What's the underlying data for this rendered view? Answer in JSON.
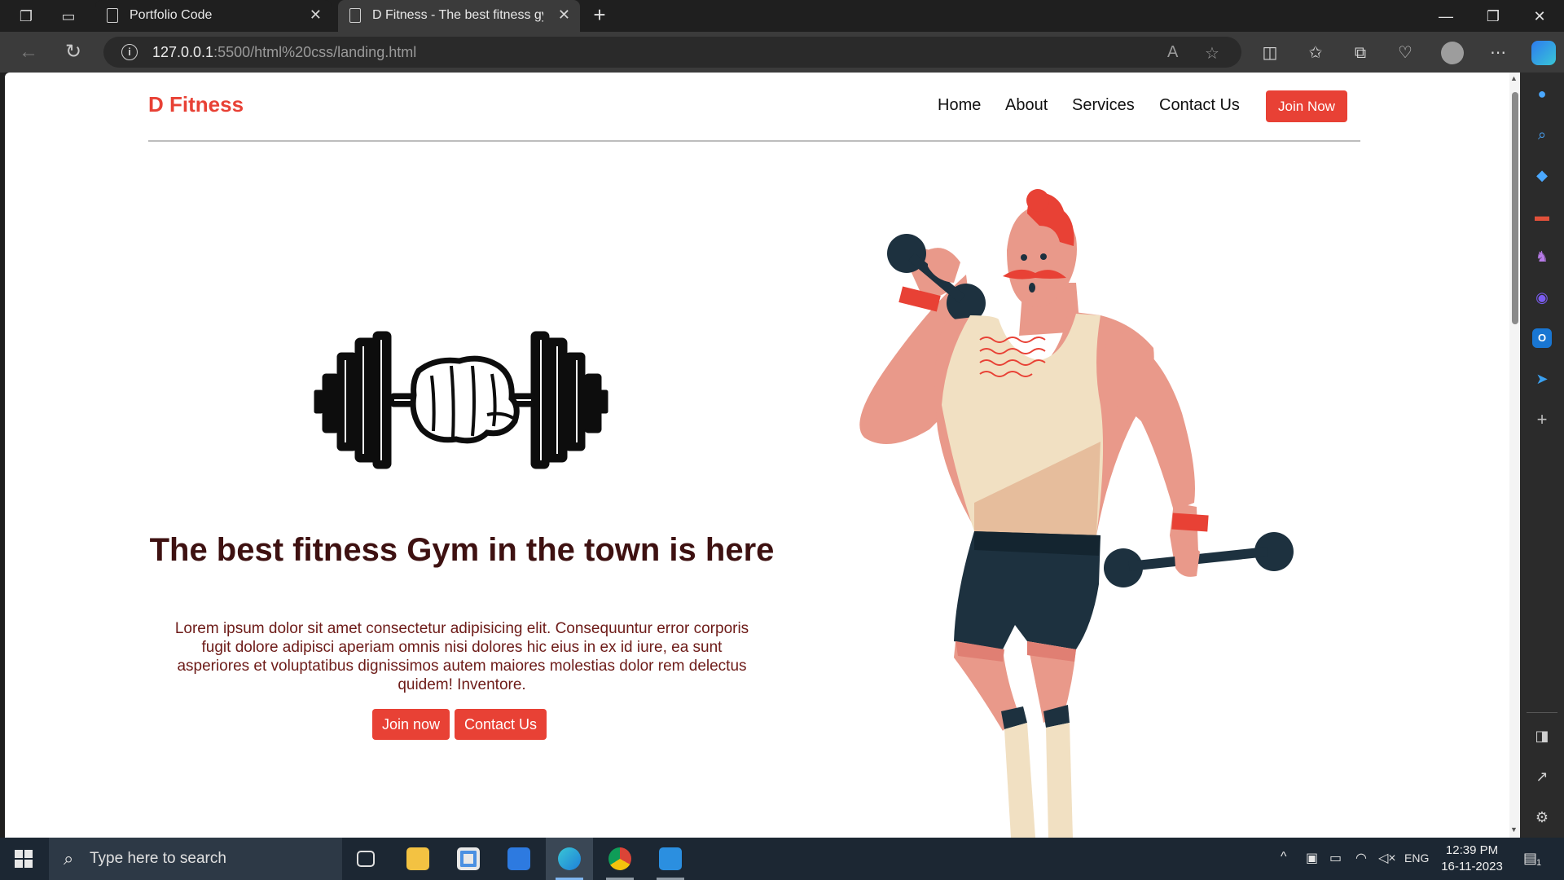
{
  "browser": {
    "tabs": [
      {
        "title": "Portfolio Code",
        "active": false
      },
      {
        "title": "D Fitness - The best fitness gym in the town",
        "active": true
      }
    ],
    "url_host": "127.0.0.1",
    "url_path": ":5500/html%20css/landing.html"
  },
  "site": {
    "brand": "D Fitness",
    "nav": [
      "Home",
      "About",
      "Services",
      "Contact Us"
    ],
    "nav_cta": "Join Now",
    "hero": {
      "title": "The best fitness Gym in the town is here",
      "body": "Lorem ipsum dolor sit amet consectetur adipisicing elit. Consequuntur error corporis fugit dolore adipisci aperiam omnis nisi dolores hic eius in ex id iure, ea sunt asperiores et voluptatibus dignissimos autem maiores molestias dolor rem delectus quidem! Inventore.",
      "primary_cta": "Join now",
      "secondary_cta": "Contact Us"
    },
    "colors": {
      "accent": "#e84135",
      "heading": "#3e1111",
      "body_text": "#6d1b18"
    }
  },
  "taskbar": {
    "search_placeholder": "Type here to search",
    "language": "ENG",
    "time": "12:39 PM",
    "date": "16-11-2023",
    "notifications": "1"
  }
}
